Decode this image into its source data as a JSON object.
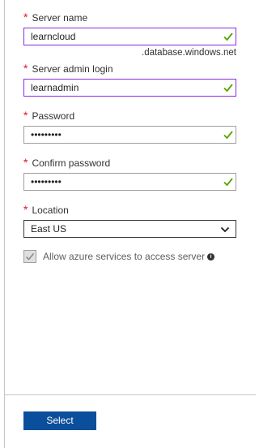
{
  "form": {
    "server_name": {
      "label": "Server name",
      "value": "learncloud",
      "suffix": ".database.windows.net",
      "valid": true
    },
    "admin_login": {
      "label": "Server admin login",
      "value": "learnadmin",
      "valid": true
    },
    "password": {
      "label": "Password",
      "value": "•••••••••",
      "valid": true
    },
    "confirm_password": {
      "label": "Confirm password",
      "value": "•••••••••",
      "valid": true
    },
    "location": {
      "label": "Location",
      "selected": "East US"
    },
    "allow_azure": {
      "label": "Allow azure services to access server",
      "checked": true,
      "disabled": true
    },
    "required_marker": "*"
  },
  "footer": {
    "select_label": "Select"
  },
  "colors": {
    "required": "#e81123",
    "valid_check": "#57a300",
    "active_border": "#8a2be2",
    "primary_button": "#0b4f9c"
  },
  "icons": {
    "valid": "checkmark-icon",
    "dropdown": "chevron-down-icon",
    "info": "info-icon",
    "checkbox": "checkbox-checked-icon"
  }
}
